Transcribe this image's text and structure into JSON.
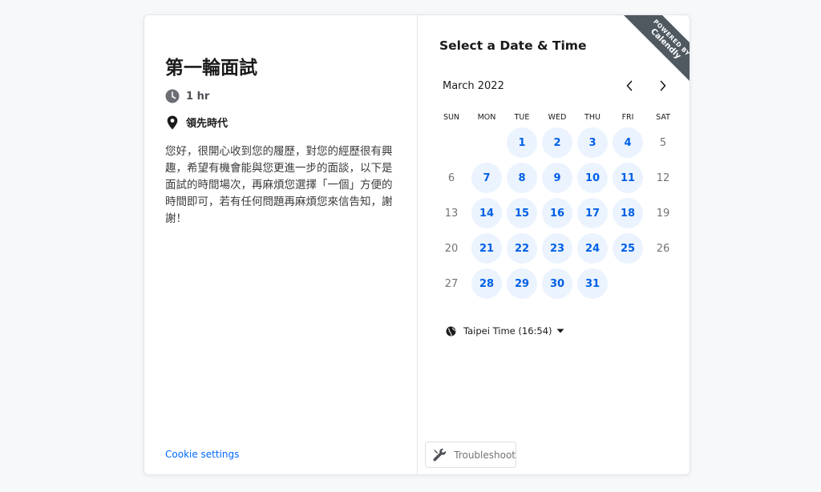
{
  "event": {
    "title": "第一輪面試",
    "duration": "1 hr",
    "location": "領先時代",
    "description": "您好，很開心收到您的履歷，對您的經歷很有興趣，希望有機會能與您更進一步的面談，以下是面試的時間場次，再麻煩您選擇「一個」方便的時間即可，若有任何問題再麻煩您來信告知，謝謝！",
    "cookie_settings": "Cookie settings"
  },
  "scheduler": {
    "title": "Select a Date & Time",
    "badge_top": "POWERED BY",
    "badge_bottom": "Calendly",
    "month": "March 2022",
    "weekdays": [
      "SUN",
      "MON",
      "TUE",
      "WED",
      "THU",
      "FRI",
      "SAT"
    ],
    "first_weekday_index": 2,
    "days_in_month": 31,
    "available_days": [
      1,
      2,
      3,
      4,
      7,
      8,
      9,
      10,
      11,
      14,
      15,
      16,
      17,
      18,
      21,
      22,
      23,
      24,
      25,
      28,
      29,
      30,
      31
    ],
    "timezone": "Taipei Time (16:54)",
    "troubleshoot": "Troubleshoot"
  },
  "colors": {
    "accent": "#0060e6",
    "available_bg": "#ebf3fe",
    "link": "#0069ff",
    "badge_bg": "#505960"
  },
  "icons": {
    "duration": "clock-icon",
    "location": "map-pin-icon",
    "timezone": "globe-icon",
    "troubleshoot": "wrench-icon",
    "prev": "chevron-left-icon",
    "next": "chevron-right-icon"
  }
}
